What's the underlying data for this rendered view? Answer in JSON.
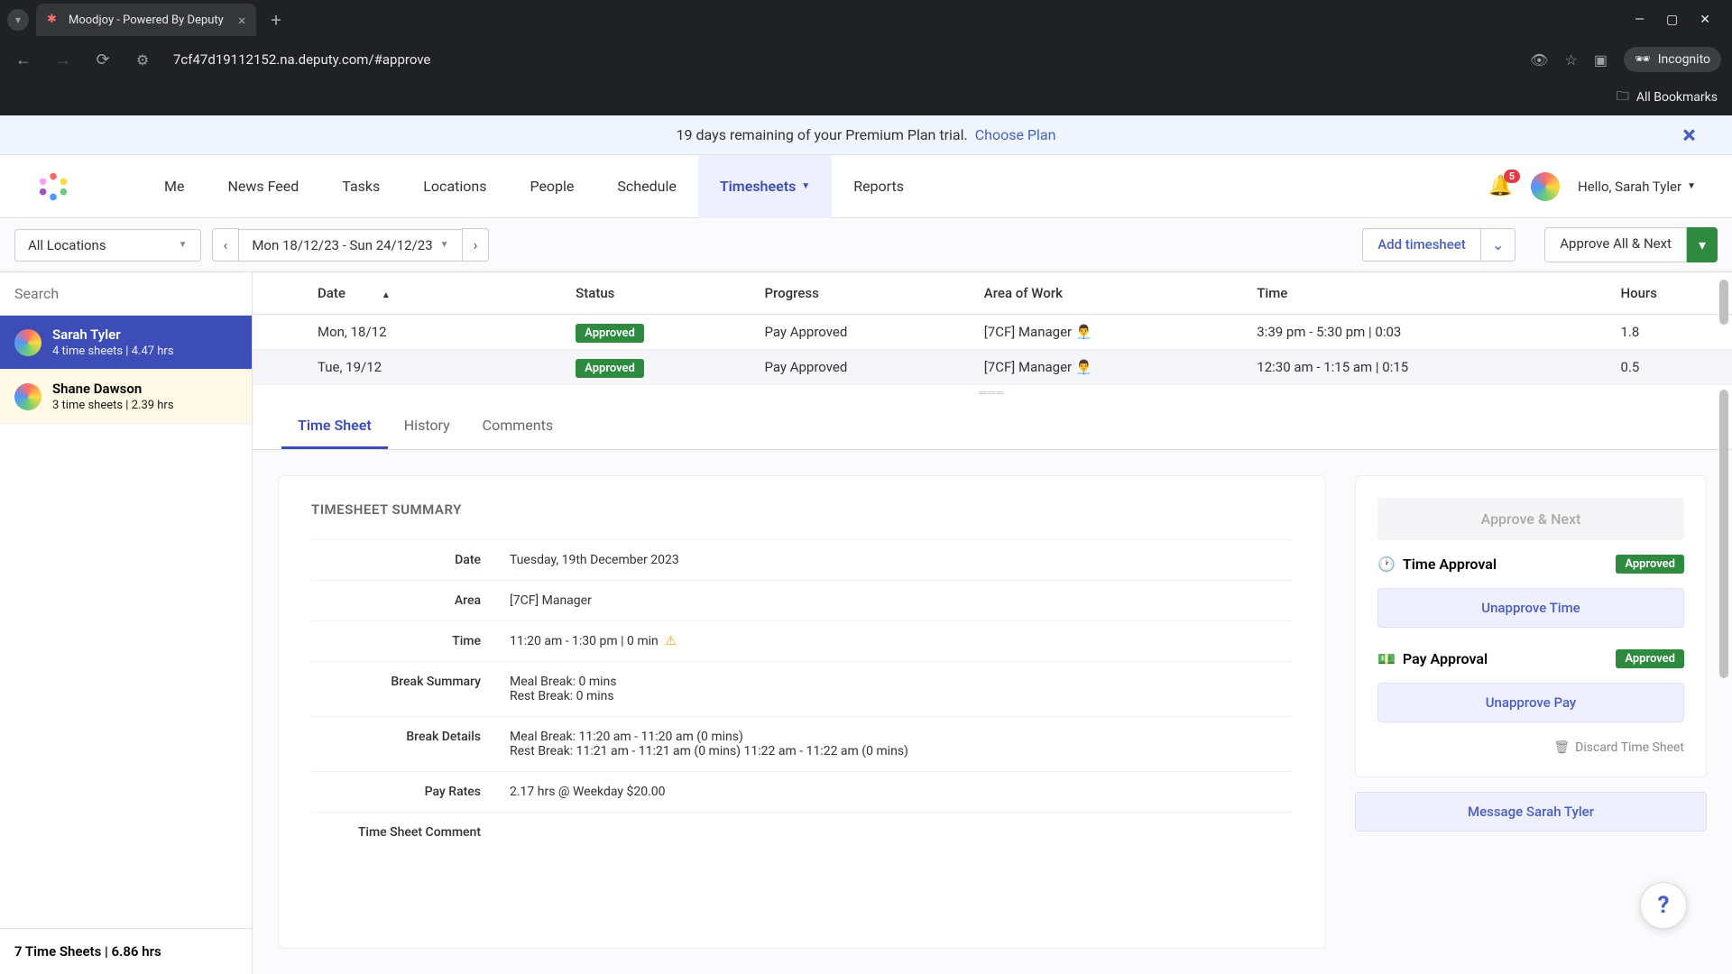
{
  "browser": {
    "tab_title": "Moodjoy - Powered By Deputy",
    "url": "7cf47d19112152.na.deputy.com/#approve",
    "incognito_label": "Incognito",
    "bookmarks_label": "All Bookmarks"
  },
  "trial": {
    "text": "19 days remaining of your Premium Plan trial.",
    "link": "Choose Plan"
  },
  "nav": {
    "items": [
      "Me",
      "News Feed",
      "Tasks",
      "Locations",
      "People",
      "Schedule",
      "Timesheets",
      "Reports"
    ],
    "active": "Timesheets",
    "badge": "5",
    "greeting": "Hello, Sarah Tyler"
  },
  "filters": {
    "location": "All Locations",
    "date_range": "Mon 18/12/23 - Sun 24/12/23",
    "add_timesheet": "Add timesheet",
    "approve_all": "Approve All & Next"
  },
  "sidebar": {
    "search_placeholder": "Search",
    "employees": [
      {
        "name": "Sarah Tyler",
        "meta": "4 time sheets | 4.47 hrs",
        "selected": true
      },
      {
        "name": "Shane Dawson",
        "meta": "3 time sheets | 2.39 hrs",
        "hover": true
      }
    ],
    "footer": "7 Time Sheets | 6.86 hrs"
  },
  "table": {
    "headers": {
      "date": "Date",
      "status": "Status",
      "progress": "Progress",
      "area": "Area of Work",
      "time": "Time",
      "hours": "Hours"
    },
    "rows": [
      {
        "date": "Mon, 18/12",
        "status": "Approved",
        "progress": "Pay Approved",
        "area": "[7CF] Manager",
        "time": "3:39 pm - 5:30 pm | 0:03",
        "hours": "1.8"
      },
      {
        "date": "Tue, 19/12",
        "status": "Approved",
        "progress": "Pay Approved",
        "area": "[7CF] Manager",
        "time": "12:30 am - 1:15 am | 0:15",
        "hours": "0.5",
        "selected": true
      }
    ]
  },
  "tabs": {
    "items": [
      "Time Sheet",
      "History",
      "Comments"
    ],
    "active": "Time Sheet"
  },
  "summary": {
    "title": "TIMESHEET SUMMARY",
    "rows": {
      "date": {
        "label": "Date",
        "value": "Tuesday, 19th December 2023"
      },
      "area": {
        "label": "Area",
        "value": "[7CF] Manager"
      },
      "time": {
        "label": "Time",
        "value": "11:20 am - 1:30 pm | 0 min",
        "warn": true
      },
      "break_summary": {
        "label": "Break Summary",
        "value": "Meal Break: 0 mins\nRest Break: 0 mins"
      },
      "break_details": {
        "label": "Break Details",
        "value": "Meal Break: 11:20 am - 11:20 am (0 mins)\nRest Break: 11:21 am - 11:21 am (0 mins) 11:22 am - 11:22 am (0 mins)"
      },
      "pay_rates": {
        "label": "Pay Rates",
        "value": "2.17 hrs @ Weekday $20.00"
      },
      "comment": {
        "label": "Time Sheet Comment",
        "value": ""
      }
    }
  },
  "actions": {
    "approve_next": "Approve & Next",
    "time_approval": {
      "label": "Time Approval",
      "status": "Approved",
      "button": "Unapprove Time"
    },
    "pay_approval": {
      "label": "Pay Approval",
      "status": "Approved",
      "button": "Unapprove Pay"
    },
    "discard": "Discard Time Sheet",
    "message": "Message Sarah Tyler"
  }
}
